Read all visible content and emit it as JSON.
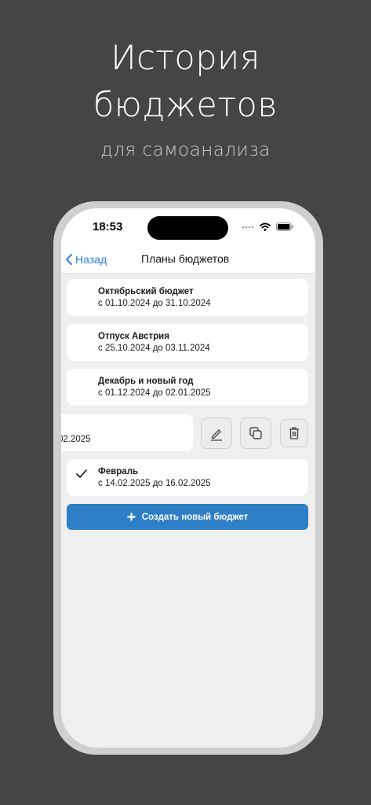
{
  "promo": {
    "title_line1": "История",
    "title_line2": "бюджетов",
    "subtitle": "для самоанализа"
  },
  "status_bar": {
    "time": "18:53",
    "icons": [
      "signal-dots-icon",
      "wifi-icon",
      "battery-icon"
    ]
  },
  "nav": {
    "back_label": "Назад",
    "title": "Планы бюджетов"
  },
  "budgets": [
    {
      "name": "Октябрьский бюджет",
      "dates": "с 01.10.2024 до 31.10.2024",
      "selected": false
    },
    {
      "name": "Отпуск Австрия",
      "dates": "с 25.10.2024 до 03.11.2024",
      "selected": false
    },
    {
      "name": "Декабрь и новый год",
      "dates": "с 01.12.2024 до 02.01.2025",
      "selected": false
    },
    {
      "name": "",
      "dates": "02.2025",
      "selected": false,
      "swiped": true
    },
    {
      "name": "Февраль",
      "dates": "с 14.02.2025 до 16.02.2025",
      "selected": true
    }
  ],
  "swipe_actions": [
    "edit-icon",
    "copy-icon",
    "trash-icon"
  ],
  "create_button": {
    "icon": "plus-icon",
    "label": "Создать новый бюджет"
  },
  "colors": {
    "background": "#454545",
    "accent": "#2e7fc6",
    "link": "#2f7fe0"
  }
}
